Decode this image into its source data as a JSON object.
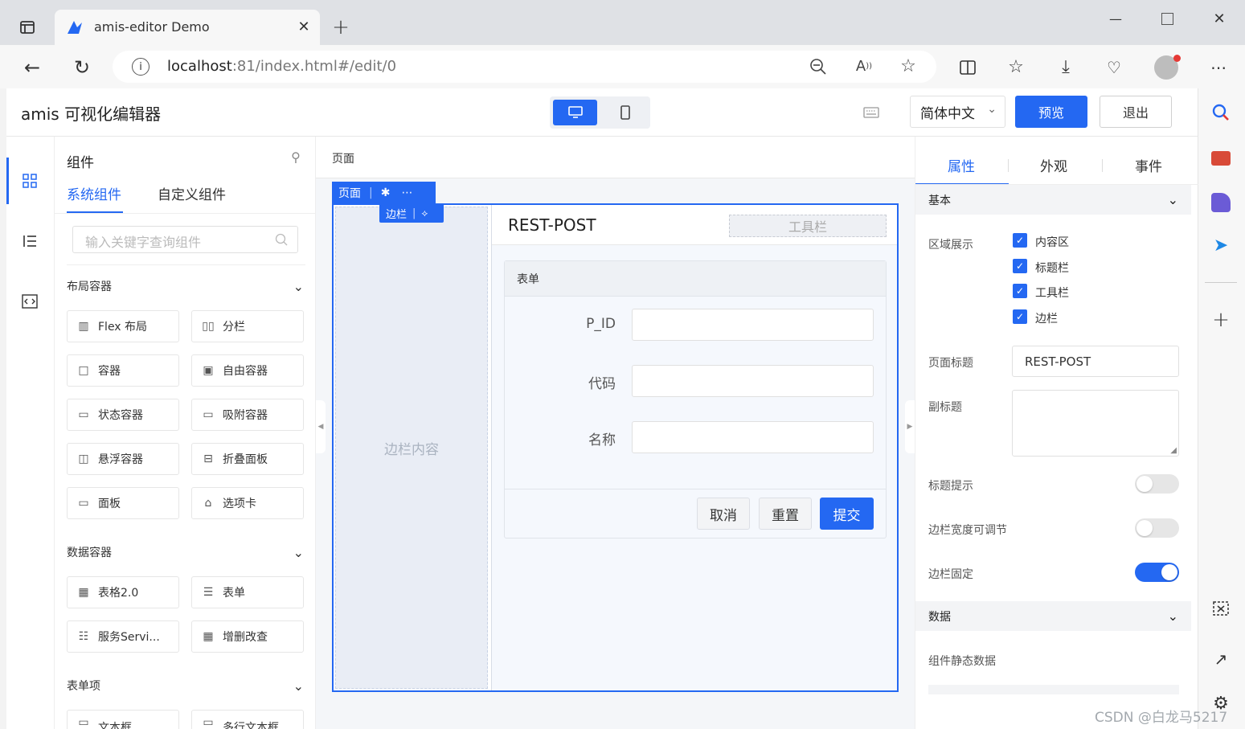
{
  "browser": {
    "tab_title": "amis-editor Demo",
    "url_host": "localhost",
    "url_rest": ":81/index.html#/edit/0"
  },
  "header": {
    "title": "amis 可视化编辑器",
    "language": "简体中文",
    "preview": "预览",
    "exit": "退出"
  },
  "left_panel": {
    "title": "组件",
    "tabs": [
      "系统组件",
      "自定义组件"
    ],
    "search_placeholder": "输入关键字查询组件",
    "sections": [
      {
        "title": "布局容器",
        "items": [
          "Flex 布局",
          "分栏",
          "容器",
          "自由容器",
          "状态容器",
          "吸附容器",
          "悬浮容器",
          "折叠面板",
          "面板",
          "选项卡"
        ]
      },
      {
        "title": "数据容器",
        "items": [
          "表格2.0",
          "表单",
          "服务Servi...",
          "增删改查"
        ]
      },
      {
        "title": "表单项",
        "items": [
          "文本框",
          "多行文本框"
        ]
      }
    ]
  },
  "canvas": {
    "breadcrumb": "页面",
    "page_tag": "页面",
    "aside_tag": "边栏",
    "aside_content": "边栏内容",
    "page_title": "REST-POST",
    "toolbar_placeholder": "工具栏",
    "form_title": "表单",
    "fields": [
      "P_ID",
      "代码",
      "名称"
    ],
    "buttons": {
      "cancel": "取消",
      "reset": "重置",
      "submit": "提交"
    }
  },
  "right_panel": {
    "tabs": [
      "属性",
      "外观",
      "事件"
    ],
    "section_basic": "基本",
    "region_label": "区域展示",
    "regions": [
      "内容区",
      "标题栏",
      "工具栏",
      "边栏"
    ],
    "page_title_label": "页面标题",
    "page_title_value": "REST-POST",
    "subtitle_label": "副标题",
    "title_tip_label": "标题提示",
    "title_tip_on": false,
    "aside_resizable_label": "边栏宽度可调节",
    "aside_resizable_on": false,
    "aside_fixed_label": "边栏固定",
    "aside_fixed_on": true,
    "section_data": "数据",
    "static_data_label": "组件静态数据"
  },
  "watermark": "CSDN @白龙马5217",
  "colors": {
    "primary": "#2468f2",
    "canvas_bg": "#f5f8fd"
  }
}
